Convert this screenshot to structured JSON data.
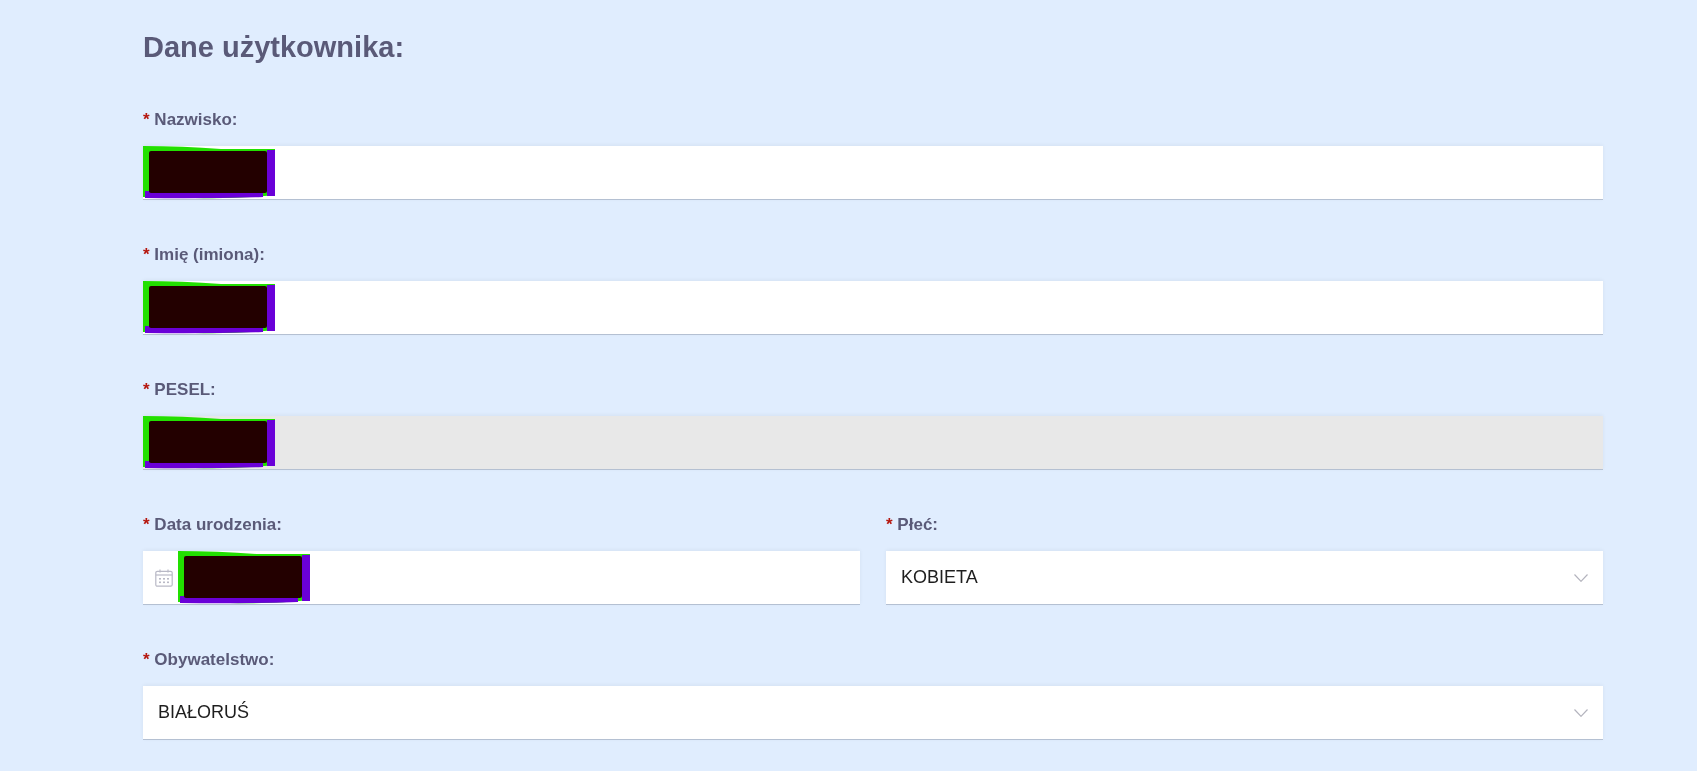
{
  "heading": "Dane użytkownika:",
  "rows": [
    {
      "fields": [
        {
          "kind": "text",
          "required_mark": "*",
          "label": "Nazwisko:",
          "redacted": true,
          "disabled": false
        }
      ]
    },
    {
      "fields": [
        {
          "kind": "text",
          "required_mark": "*",
          "label": "Imię (imiona):",
          "redacted": true,
          "disabled": false
        }
      ]
    },
    {
      "fields": [
        {
          "kind": "text",
          "required_mark": "*",
          "label": "PESEL:",
          "redacted": true,
          "disabled": true
        }
      ]
    },
    {
      "fields": [
        {
          "kind": "date",
          "required_mark": "*",
          "label": "Data urodzenia:",
          "redacted": true,
          "disabled": false
        },
        {
          "kind": "select",
          "required_mark": "*",
          "label": "Płeć:",
          "value": "KOBIETA",
          "disabled": false
        }
      ]
    },
    {
      "fields": [
        {
          "kind": "select",
          "required_mark": "*",
          "label": "Obywatelstwo:",
          "value": "BIAŁORUŚ",
          "disabled": false
        }
      ]
    }
  ]
}
